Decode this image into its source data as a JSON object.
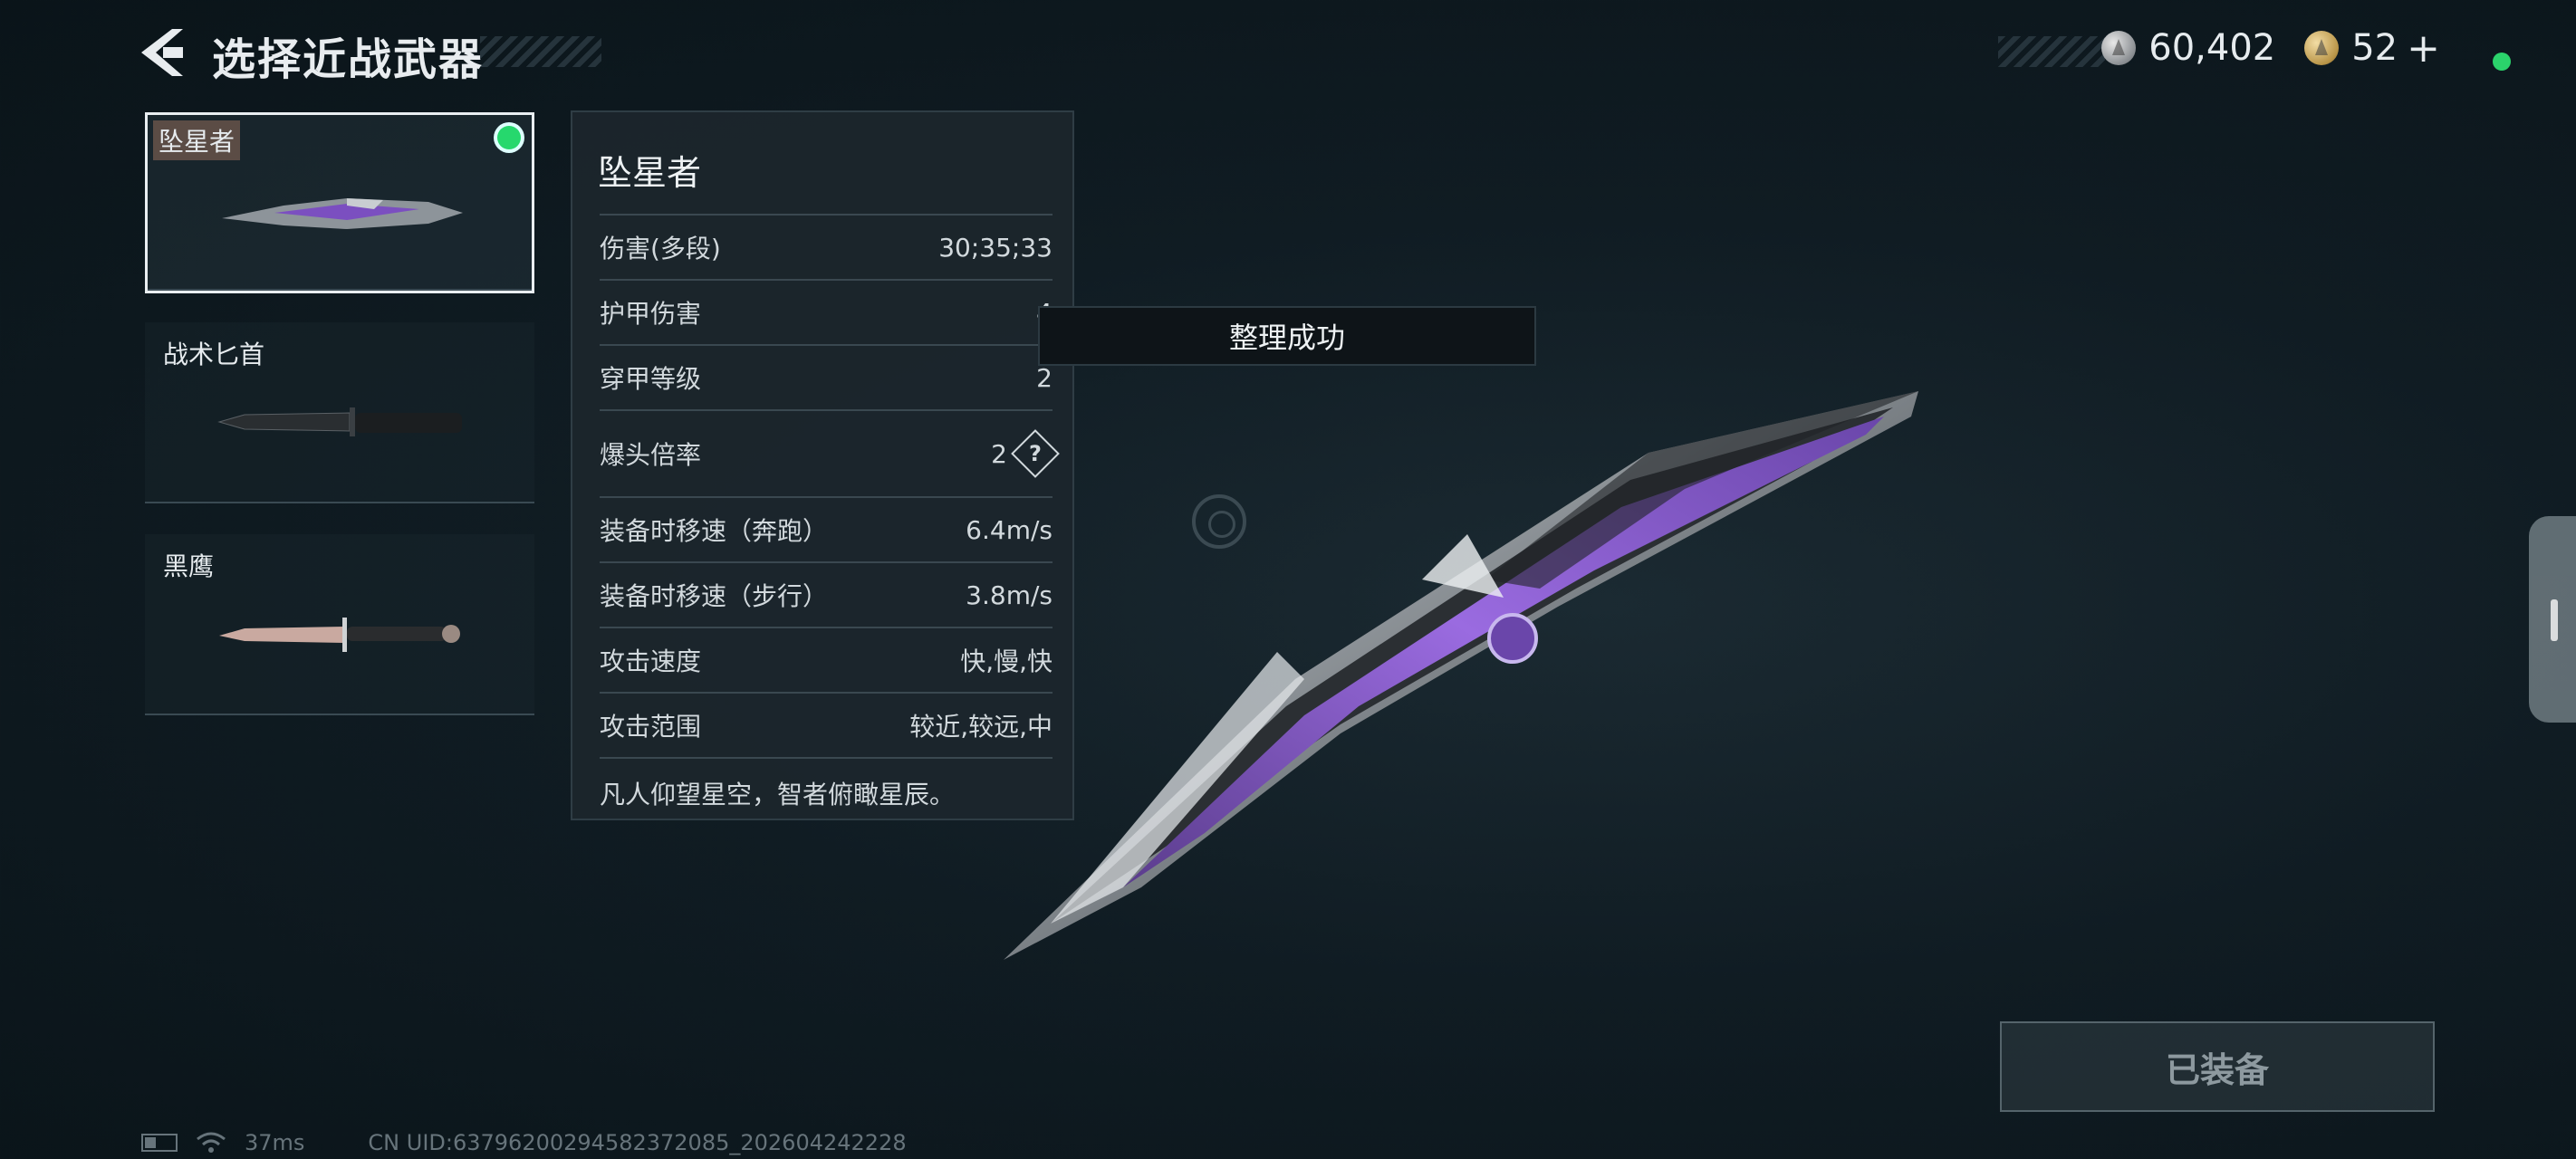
{
  "header": {
    "title": "选择近战武器"
  },
  "currency": {
    "silver": "60,402",
    "gold": "52",
    "plus": "+"
  },
  "weapons": [
    {
      "name": "坠星者",
      "selected": true
    },
    {
      "name": "战术匕首",
      "selected": false
    },
    {
      "name": "黑鹰",
      "selected": false
    }
  ],
  "stats": {
    "title": "坠星者",
    "rows": [
      {
        "label": "伤害(多段)",
        "value": "30;35;33"
      },
      {
        "label": "护甲伤害",
        "value": "4"
      },
      {
        "label": "穿甲等级",
        "value": "2"
      },
      {
        "label": "爆头倍率",
        "value": "2",
        "help": "?"
      },
      {
        "label": "装备时移速（奔跑）",
        "value": "6.4m/s"
      },
      {
        "label": "装备时移速（步行）",
        "value": "3.8m/s"
      },
      {
        "label": "攻击速度",
        "value": "快,慢,快"
      },
      {
        "label": "攻击范围",
        "value": "较近,较远,中"
      }
    ],
    "description": "凡人仰望星空，智者俯瞰星辰。"
  },
  "toast": "整理成功",
  "equip_button": "已装备",
  "footer": {
    "ping": "37ms",
    "uid": "CN UID:637962002945823720​85_202604242228"
  },
  "colors": {
    "accent_green": "#26d86d",
    "knife_purple": "#8a5cc9"
  },
  "icons": [
    "back-arrow-icon",
    "silver-coin-icon",
    "gold-coin-icon",
    "battery-icon",
    "wifi-icon",
    "help-icon"
  ]
}
